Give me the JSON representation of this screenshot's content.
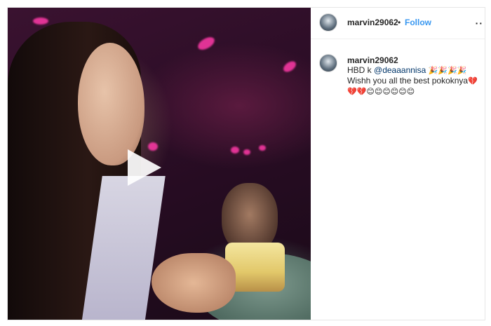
{
  "post": {
    "media": {
      "play_icon": "play-icon"
    },
    "header": {
      "username": "marvin29062",
      "separator": "•",
      "follow_label": "Follow",
      "more_label": "··"
    },
    "caption": {
      "username": "marvin29062",
      "line1_prefix": "HBD k ",
      "mention": "@deaaannisa",
      "line1_emojis": "🎉🎉🎉🎉",
      "line2_text": "Wishh you all the best pokoknya",
      "line2_emoji": "💔",
      "line3_emojis": "💔💔😊😊😊😊😊😊"
    }
  }
}
